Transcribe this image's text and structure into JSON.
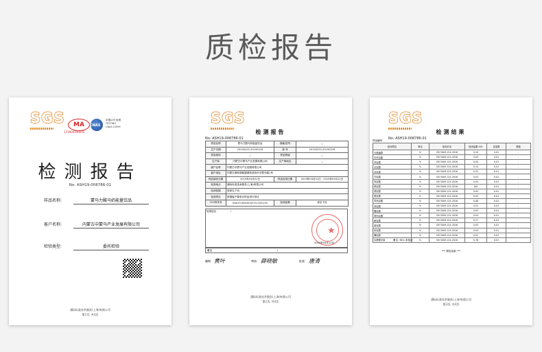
{
  "page_title": "质检报告",
  "brand": {
    "logo_text": "SGS"
  },
  "page1": {
    "ma_text": "MA",
    "ma_number": "173900340055",
    "cnas_text": "CNAS",
    "cnas_caption": "中国认可 检测 TESTING CNAS L0599",
    "title": "检测报告",
    "report_no": "No: ASH19-008786-01",
    "fields": [
      {
        "label": "样品名称:",
        "value": "蒙马力酸马奶能量饮品"
      },
      {
        "label": "客户名称:",
        "value": "内蒙古中蒙马产业发展有限公司"
      },
      {
        "label": "检验类型:",
        "value": "委托检验"
      }
    ],
    "footer": [
      "通标标准技术服务(上海)有限公司",
      "第1页, 共4页"
    ]
  },
  "page2": {
    "title": "检测报告",
    "report_no": "No: ASH19-008786-01",
    "rows": [
      [
        "样品名称",
        "蒙马力酸马奶能量饮品",
        "规格/型号",
        "/"
      ],
      [
        "生产日期",
        "20190225-20190226",
        "批 号",
        "20190225-20190226"
      ],
      [
        "样品商标",
        "/",
        "样品等级",
        "/"
      ],
      [
        "生产商",
        "内蒙古中蒙马产业发展有限公司",
        "生产商地址",
        "/"
      ],
      [
        "客户名称",
        "内蒙古中蒙马产业发展有限公司",
        "",
        ""
      ],
      [
        "客户地址",
        "内蒙古锡林郭勒盟锡林浩特市中蒙马路1号",
        "",
        ""
      ],
      [
        "样品接收日期",
        "2019年03月01日",
        "样品检测日期",
        "2019年03月01日 - 2019年03月12日"
      ],
      [
        "检测地点",
        "通标标准技术服务(上海)有限公司",
        "",
        ""
      ],
      [
        "检测依据",
        "请参见下页",
        "",
        ""
      ],
      [
        "检测项目",
        "根据客户要求对样品进行测试",
        "",
        ""
      ],
      [
        "SGS样本号",
        "SHA19-08449/QF19-0052/25",
        "检测结果",
        "参见下页"
      ]
    ],
    "conclusion_label": "检测结论",
    "conclusion_value": "/",
    "stamp_date": "2019年03月12日",
    "note_label": "备注",
    "note_value": "/",
    "signatures": [
      {
        "label": "编制:",
        "name": "黄叶"
      },
      {
        "label": "审核:",
        "name": "薛晓敏"
      },
      {
        "label": "批准:",
        "name": "唐清"
      }
    ],
    "footer": [
      "通标标准技术服务(上海)有限公司",
      "第2页, 共4页"
    ]
  },
  "page3": {
    "title": "检测结果",
    "report_no": "No: ASH19-008786-01",
    "sample_label": "样品编号",
    "headers": [
      "检测项目",
      "单位",
      "检测方法",
      "检测结果 001",
      "定量限",
      "限值"
    ],
    "rows": [
      [
        "大肠菌群",
        "%",
        "GB 5009.124-2016",
        "0.10",
        "0.01",
        "-"
      ],
      [
        "天冬氨酸",
        "%",
        "GB 5009.124-2016",
        "0.03",
        "0.01",
        "-"
      ],
      [
        "苏氨酸",
        "%",
        "GB 5009.124-2016",
        "0.04",
        "0.01",
        "-"
      ],
      [
        "丝氨酸",
        "%",
        "GB 5009.124-2016",
        "0.14",
        "0.01",
        "-"
      ],
      [
        "谷氨酸",
        "%",
        "GB 5009.124-2016",
        "0.52",
        "0.01",
        "-"
      ],
      [
        "甘氨酸",
        "%",
        "GB 5009.124-2016",
        "0.03",
        "0.01",
        "-"
      ],
      [
        "丙氨酸",
        "%",
        "GB 5009.124-2016",
        "0.04",
        "0.01",
        "-"
      ],
      [
        "胱氨酸",
        "%",
        "GB 5009.124-2016",
        "ND",
        "0.01",
        "-"
      ],
      [
        "缬氨酸",
        "%",
        "GB 5009.124-2016",
        "0.05",
        "0.01",
        "-"
      ],
      [
        "蛋氨酸",
        "%",
        "GB 5009.124-2016",
        "0.03",
        "0.01",
        "-"
      ],
      [
        "异亮氨酸",
        "%",
        "GB 5009.124-2016",
        "0.08",
        "0.01",
        "-"
      ],
      [
        "亮氨酸",
        "%",
        "GB 5009.124-2016",
        "0.52",
        "0.01",
        "-"
      ],
      [
        "酪氨酸",
        "%",
        "GB 5009.124-2016",
        "0.03",
        "0.01",
        "-"
      ],
      [
        "苯丙氨酸",
        "%",
        "GB 5009.124-2016",
        "0.04",
        "0.01",
        "-"
      ],
      [
        "赖氨酸",
        "%",
        "GB 5009.124-2016",
        "0.57",
        "0.01",
        "-"
      ],
      [
        "组氨酸",
        "%",
        "GB 5009.124-2016",
        "0.03",
        "0.01",
        "-"
      ],
      [
        "精氨酸",
        "%",
        "GB 5009.124-2016",
        "0.04",
        "0.01",
        "-"
      ],
      [
        "脯氨酸",
        "%",
        "GB 5009.124-2016",
        "0.52",
        "0.01",
        "-"
      ],
      [
        "氨基酸总量",
        "%",
        "GB 5009.124-2016",
        "0.76",
        "0.01",
        "-"
      ]
    ],
    "note": "备注: ND=未检出",
    "end_mark": "*** 报告结束 ***",
    "footer": [
      "通标标准技术服务(上海)有限公司",
      "第3页, 共4页"
    ]
  }
}
